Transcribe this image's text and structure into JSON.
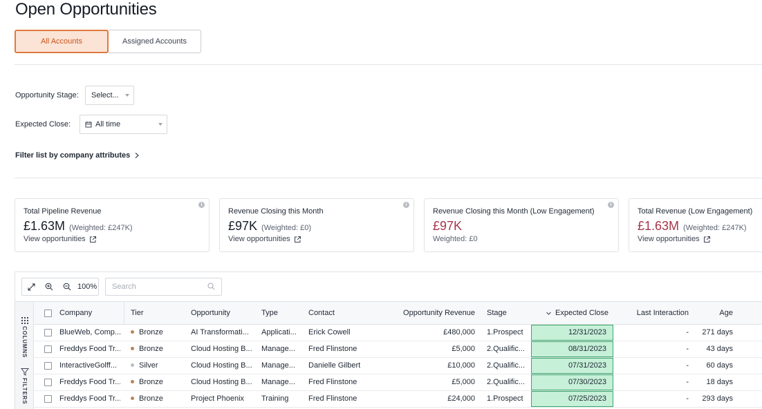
{
  "page": {
    "title": "Open Opportunities"
  },
  "account_tabs": [
    {
      "label": "All Accounts",
      "active": true
    },
    {
      "label": "Assigned Accounts",
      "active": false
    }
  ],
  "filters": {
    "stage_label": "Opportunity Stage:",
    "stage_value": "Select...",
    "close_label": "Expected Close:",
    "close_value": "All time",
    "attributes_link": "Filter list by company attributes"
  },
  "cards": [
    {
      "title": "Total Pipeline Revenue",
      "value": "£1.63M",
      "weighted": "(Weighted: £247K)",
      "link": "View opportunities"
    },
    {
      "title": "Revenue Closing this Month",
      "value": "£97K",
      "weighted": "(Weighted: £0)",
      "link": "View opportunities"
    },
    {
      "title": "Revenue Closing this Month (Low Engagement)",
      "value": "£97K",
      "weighted_line": "Weighted: £0"
    },
    {
      "title": "Total Revenue (Low Engagement)",
      "value": "£1.63M",
      "weighted": "(Weighted: £247K)",
      "link": "View opportunities"
    }
  ],
  "toolbar": {
    "zoom": "100%",
    "search_placeholder": "Search"
  },
  "side_tools": {
    "columns": "COLUMNS",
    "filters": "FILTERS"
  },
  "columns": {
    "company": "Company",
    "tier": "Tier",
    "opportunity": "Opportunity",
    "type": "Type",
    "contact": "Contact",
    "revenue": "Opportunity Revenue",
    "stage": "Stage",
    "expected_close": "Expected Close",
    "last_interaction": "Last Interaction",
    "age": "Age"
  },
  "tier_colors": {
    "Bronze": "#b8865a",
    "Silver": "#b9bdc4"
  },
  "rows": [
    {
      "company": "BlueWeb, Comp...",
      "tier": "Bronze",
      "opportunity": "AI Transformati...",
      "type": "Applicati...",
      "contact": "Erick Cowell",
      "revenue": "£480,000",
      "stage": "1.Prospect",
      "expected_close": "12/31/2023",
      "last_interaction": "-",
      "age": "271 days"
    },
    {
      "company": "Freddys Food Tr...",
      "tier": "Bronze",
      "opportunity": "Cloud Hosting B...",
      "type": "Manage...",
      "contact": "Fred Flinstone",
      "revenue": "£5,000",
      "stage": "2.Qualific...",
      "expected_close": "08/31/2023",
      "last_interaction": "-",
      "age": "43 days"
    },
    {
      "company": "InteractiveGolff...",
      "tier": "Silver",
      "opportunity": "Cloud Hosting B...",
      "type": "Manage...",
      "contact": "Danielle Gilbert",
      "revenue": "£10,000",
      "stage": "2.Qualific...",
      "expected_close": "07/31/2023",
      "last_interaction": "-",
      "age": "60 days"
    },
    {
      "company": "Freddys Food Tr...",
      "tier": "Bronze",
      "opportunity": "Cloud Hosting B...",
      "type": "Manage...",
      "contact": "Fred Flinstone",
      "revenue": "£5,000",
      "stage": "2.Qualific...",
      "expected_close": "07/30/2023",
      "last_interaction": "-",
      "age": "18 days"
    },
    {
      "company": "Freddys Food Tr...",
      "tier": "Bronze",
      "opportunity": "Project Phoenix",
      "type": "Training",
      "contact": "Fred Flinstone",
      "revenue": "£24,000",
      "stage": "1.Prospect",
      "expected_close": "07/25/2023",
      "last_interaction": "-",
      "age": "293 days"
    }
  ]
}
